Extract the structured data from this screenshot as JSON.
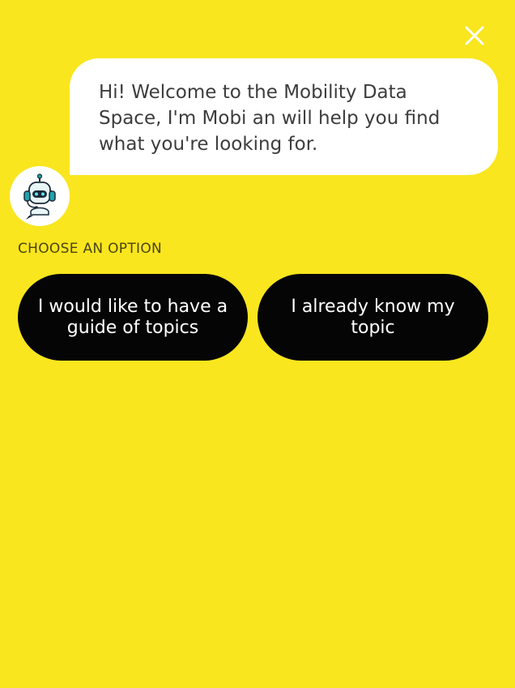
{
  "header": {
    "close_icon": "close-icon"
  },
  "chat": {
    "bot_avatar_icon": "robot-headset-icon",
    "welcome_message": "Hi! Welcome to the Mobility Data Space, I'm Mobi an will help you find what you're looking for."
  },
  "options": {
    "heading": "CHOOSE AN OPTION",
    "items": [
      {
        "label": "I would like to have a guide of topics"
      },
      {
        "label": "I already know my topic"
      }
    ]
  },
  "colors": {
    "background": "#f9e61e",
    "bubble": "#ffffff",
    "button": "#050505",
    "button_text": "#ffffff",
    "avatar_accent": "#1fa3ad"
  }
}
